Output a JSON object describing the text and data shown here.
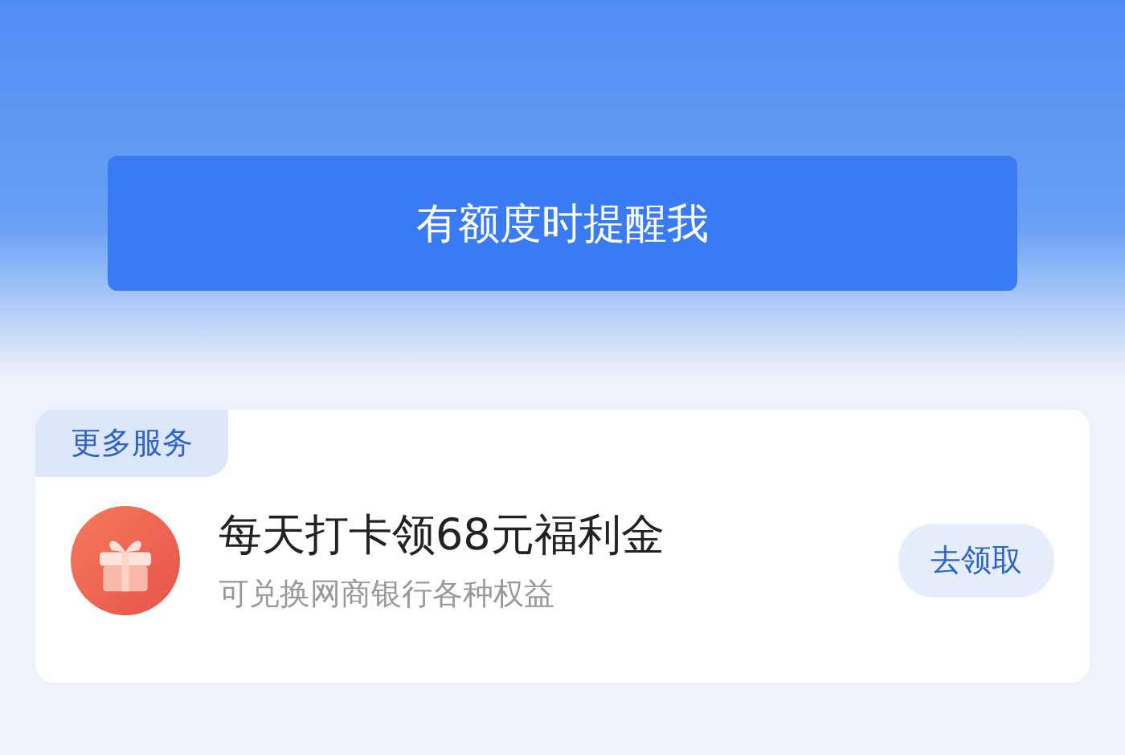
{
  "remind_button": {
    "label": "有额度时提醒我"
  },
  "section": {
    "tag": "更多服务",
    "items": [
      {
        "title": "每天打卡领68元福利金",
        "subtitle": "可兑换网商银行各种权益",
        "action": "去领取"
      }
    ]
  }
}
